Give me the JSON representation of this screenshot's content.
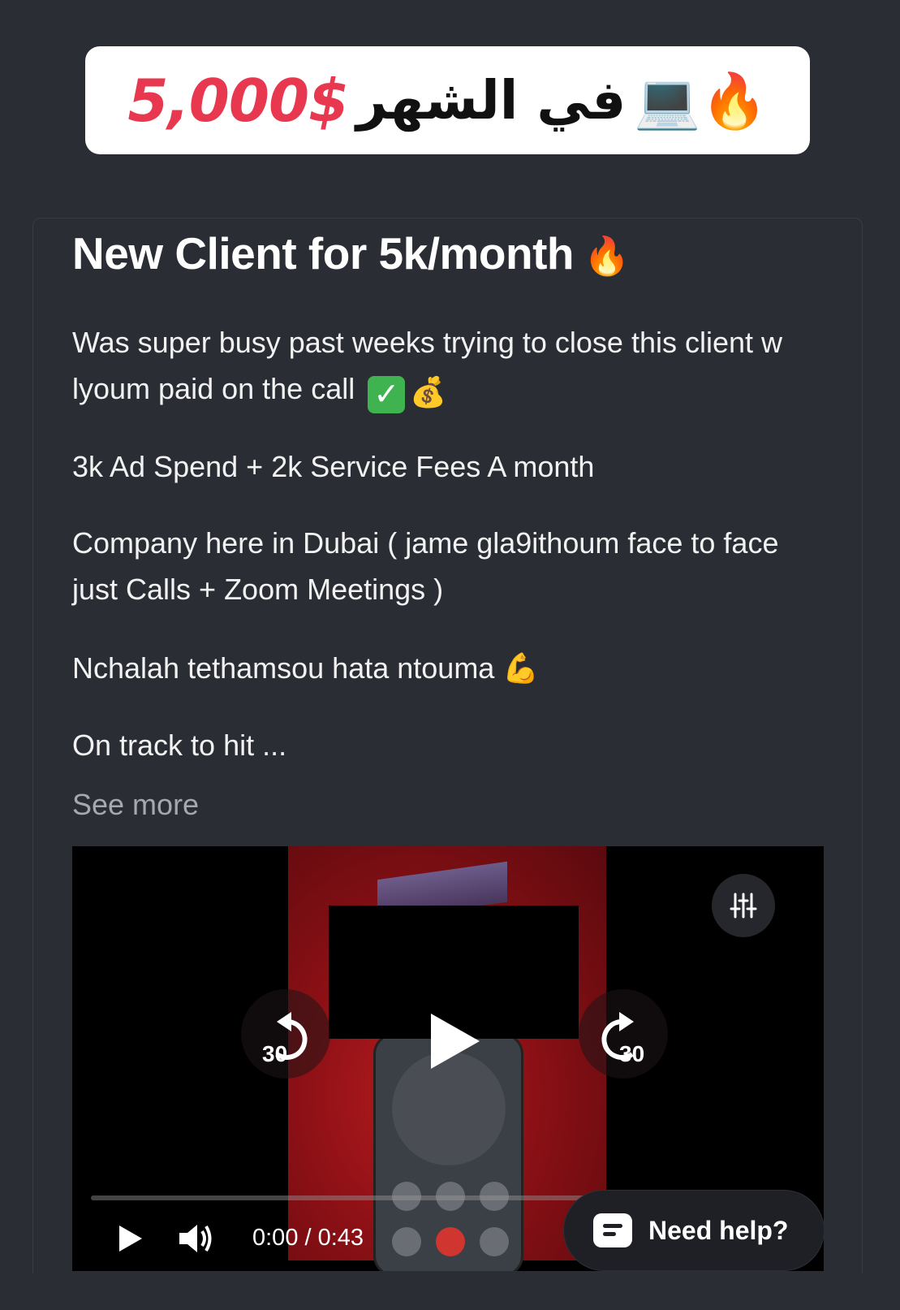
{
  "banner": {
    "amount": "5,000$",
    "arabic_text": "في الشهر",
    "emojis": "💻🔥"
  },
  "post": {
    "title": "New Client for 5k/month",
    "title_emoji": "🔥",
    "paragraphs": {
      "p1": "Was super busy past weeks trying to close this client w lyoum paid on the call",
      "p2": "3k Ad Spend + 2k Service Fees A month",
      "p3": "Company here in Dubai ( jame gla9ithoum face to face just Calls + Zoom Meetings )",
      "p4": "Nchalah tethamsou hata ntouma",
      "p5": "On track to hit ..."
    },
    "see_more": "See more"
  },
  "video": {
    "time": "0:00 / 0:43",
    "progress": 0.0,
    "skip_back": "30",
    "skip_forward": "30"
  },
  "help_button": {
    "label": "Need help?"
  },
  "colors": {
    "background": "#2a2d34",
    "banner_amount": "#e8384f",
    "text": "#f2f2f2",
    "muted": "#a5a8ae"
  }
}
